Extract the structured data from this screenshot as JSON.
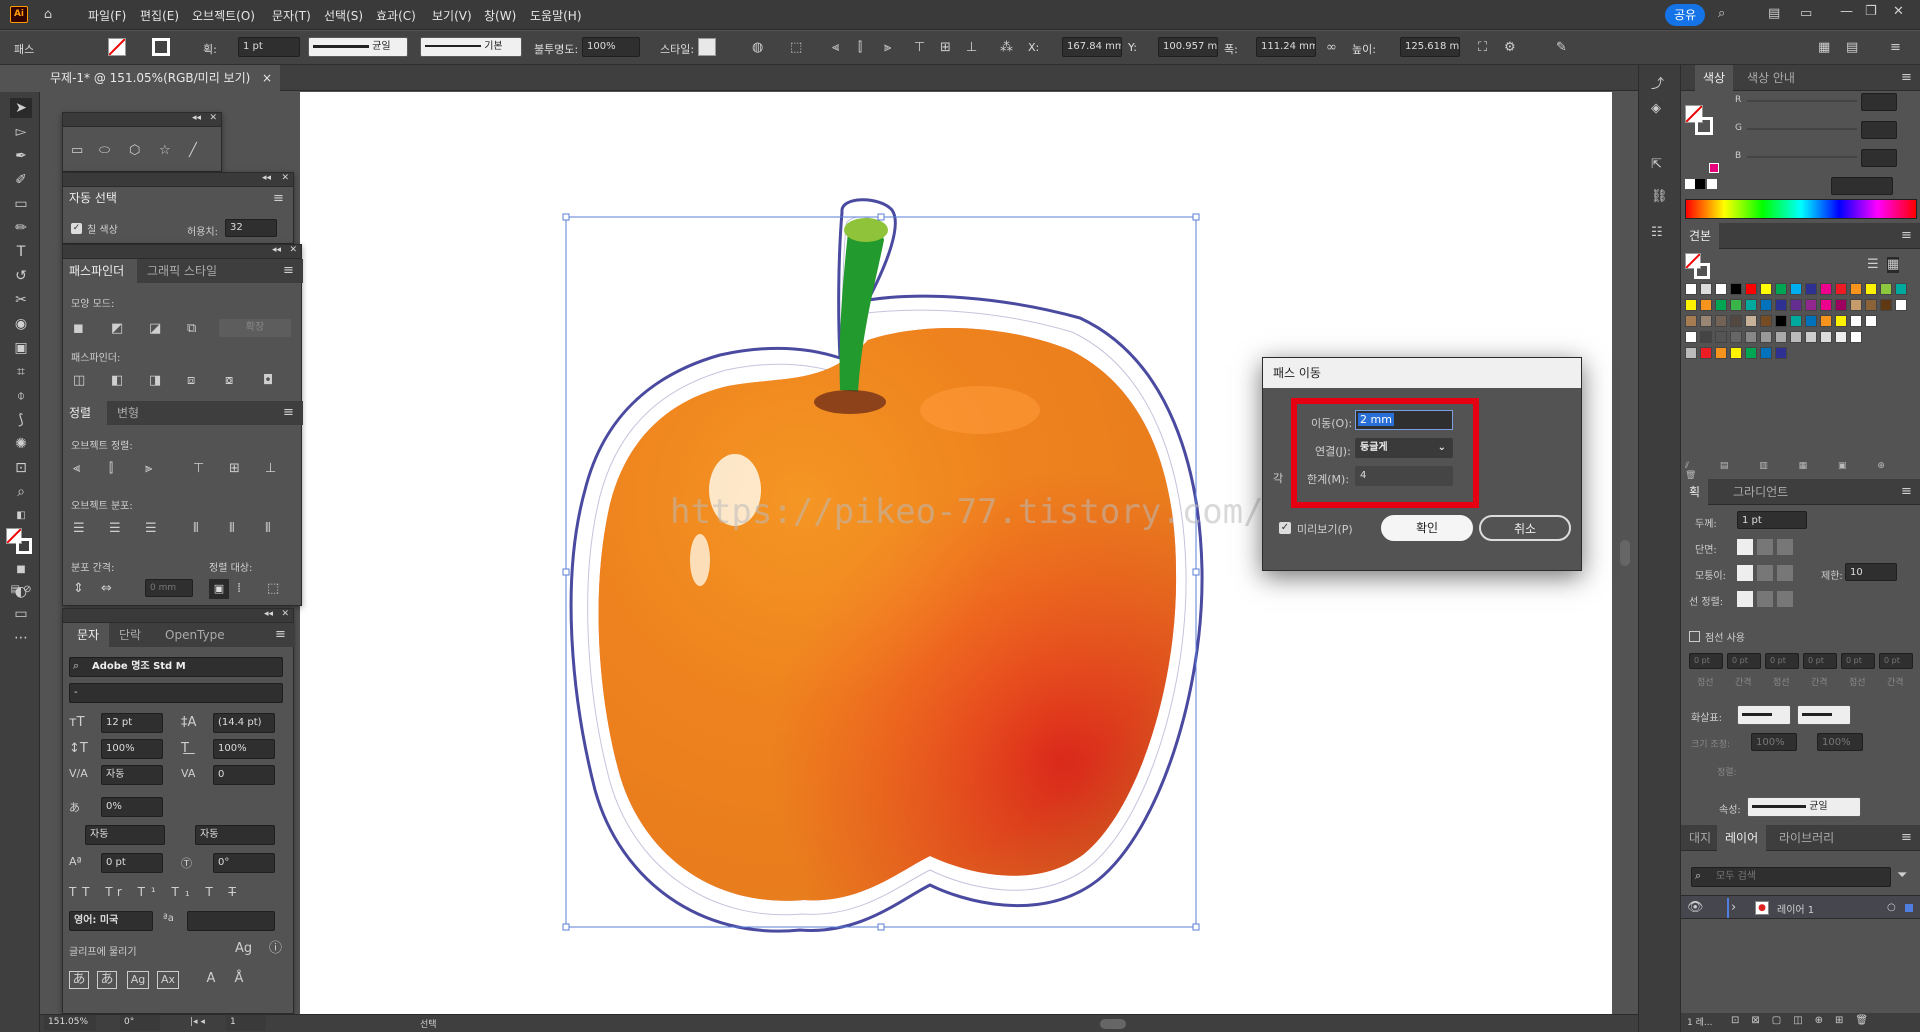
{
  "app": {
    "logo": "Ai"
  },
  "menubar": {
    "items": [
      "파일(F)",
      "편집(E)",
      "오브젝트(O)",
      "문자(T)",
      "선택(S)",
      "효과(C)",
      "보기(V)",
      "창(W)",
      "도움말(H)"
    ],
    "share_label": "공유"
  },
  "control_bar": {
    "object_type": "패스",
    "stroke_label": "획:",
    "stroke_weight": "1 pt",
    "profile_label": "균일",
    "brush_label": "기본",
    "opacity_label": "불투명도:",
    "opacity_value": "100%",
    "style_label": "스타일:",
    "x_label": "X:",
    "x_value": "167.84 mm",
    "y_label": "Y:",
    "y_value": "100.957 m",
    "w_label": "폭:",
    "w_value": "111.24 mm",
    "h_label": "높이:",
    "h_value": "125.618 m"
  },
  "document": {
    "tab_title": "무제-1* @ 151.05%(RGB/미리 보기)",
    "close": "×"
  },
  "watermark": "https://pikeo-77.tistory.com/",
  "auto_select_panel": {
    "title": "자동 선택",
    "fill_checkbox_label": "칠 색상",
    "tolerance_label": "허용치:",
    "tolerance_value": "32"
  },
  "pathfinder_panel": {
    "tabs": [
      "패스파인더",
      "그래픽 스타일"
    ],
    "shape_modes_label": "모양 모드:",
    "expand_label": "확장",
    "pathfinders_label": "패스파인더:"
  },
  "align_panel": {
    "tabs": [
      "정렬",
      "변형"
    ],
    "align_objects_label": "오브젝트 정렬:",
    "distribute_objects_label": "오브젝트 분포:",
    "distribute_spacing_label": "분포 간격:",
    "align_to_label": "정렬 대상:",
    "spacing_value": "0 mm"
  },
  "character_panel": {
    "tabs": [
      "문자",
      "단락",
      "OpenType"
    ],
    "font_family": "Adobe 명조 Std M",
    "font_style": "-",
    "font_size": "12 pt",
    "leading": "(14.4 pt)",
    "vertical_scale": "100%",
    "horizontal_scale": "100%",
    "kerning": "자동",
    "tracking": "0",
    "tsume": "0%",
    "aki_left": "자동",
    "aki_right": "자동",
    "baseline_shift": "0 pt",
    "rotation": "0°",
    "language": "영어: 미국",
    "snap_to_glyph_label": "글리프에 물리기",
    "aa_label": "ªa"
  },
  "offset_path_dialog": {
    "title": "패스 이동",
    "offset_label": "이동(O):",
    "offset_value": "2 mm",
    "joins_label": "연결(J):",
    "joins_value": "둥글게",
    "miter_label": "한계(M):",
    "miter_value": "4",
    "angle_fragment": "각",
    "preview_label": "미리보기(P)",
    "ok_label": "확인",
    "cancel_label": "취소",
    "highlight_color": "#e60012"
  },
  "color_panel": {
    "tabs": [
      "색상",
      "색상 안내"
    ],
    "r_label": "R",
    "g_label": "G",
    "b_label": "B"
  },
  "swatches_panel": {
    "title": "견본"
  },
  "stroke_panel": {
    "tabs": [
      "획",
      "그라디언트"
    ],
    "weight_label": "두께:",
    "weight_value": "1 pt",
    "cap_label": "단면:",
    "corner_label": "모퉁이:",
    "limit_label": "제한:",
    "limit_value": "10",
    "align_label": "선 정렬:",
    "dashed_label": "점선 사용",
    "dash_fields": [
      "0 pt",
      "0 pt",
      "0 pt",
      "0 pt",
      "0 pt",
      "0 pt"
    ],
    "dash_labels": [
      "점선",
      "간격",
      "점선",
      "간격",
      "점선",
      "간격"
    ],
    "arrowheads_label": "화살표:",
    "scale_label": "크기 조정:",
    "scale_values": [
      "100%",
      "100%"
    ],
    "align_arrow_label": "정렬:",
    "profile_label": "속성:",
    "profile_value": "균일"
  },
  "layers_panel": {
    "tabs": [
      "대지",
      "레이어",
      "라이브러리"
    ],
    "search_placeholder": "모두 검색",
    "layer_name": "레이어 1",
    "footer_count": "1 레..."
  },
  "status_bar": {
    "zoom": "151.05%",
    "rotation": "0°",
    "artboard_num": "1",
    "tool": "선택"
  }
}
